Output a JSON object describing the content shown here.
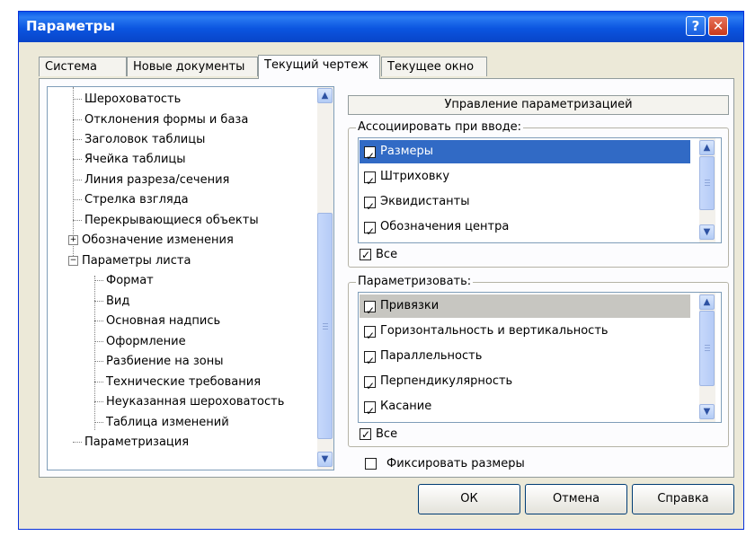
{
  "window": {
    "title": "Параметры",
    "help": "?",
    "close": "✕"
  },
  "tabs": [
    "Система",
    "Новые документы",
    "Текущий чертеж",
    "Текущее окно"
  ],
  "tree": {
    "items": [
      "Шероховатость",
      "Отклонения формы и база",
      "Заголовок таблицы",
      "Ячейка таблицы",
      "Линия разреза/сечения",
      "Стрелка взгляда",
      "Перекрывающиеся объекты",
      "Обозначение изменения",
      "Параметры листа",
      "Формат",
      "Вид",
      "Основная надпись",
      "Оформление",
      "Разбиение на зоны",
      "Технические требования",
      "Неуказанная шероховатость",
      "Таблица изменений",
      "Параметризация"
    ],
    "expander_plus": "+",
    "expander_minus": "−"
  },
  "section_title": "Управление параметризацией",
  "associate": {
    "label": "Ассоциировать при вводе:",
    "items": [
      "Размеры",
      "Штриховку",
      "Эквидистанты",
      "Обозначения центра"
    ],
    "all_label": "Все"
  },
  "parametrize": {
    "label": "Параметризовать:",
    "items": [
      "Привязки",
      "Горизонтальность и вертикальность",
      "Параллельность",
      "Перпендикулярность",
      "Касание"
    ],
    "all_label": "Все"
  },
  "fix_sizes_label": "Фиксировать размеры",
  "buttons": {
    "ok": "ОК",
    "cancel": "Отмена",
    "help": "Справка"
  },
  "scroll_arrows": {
    "up": "▲",
    "down": "▼"
  }
}
